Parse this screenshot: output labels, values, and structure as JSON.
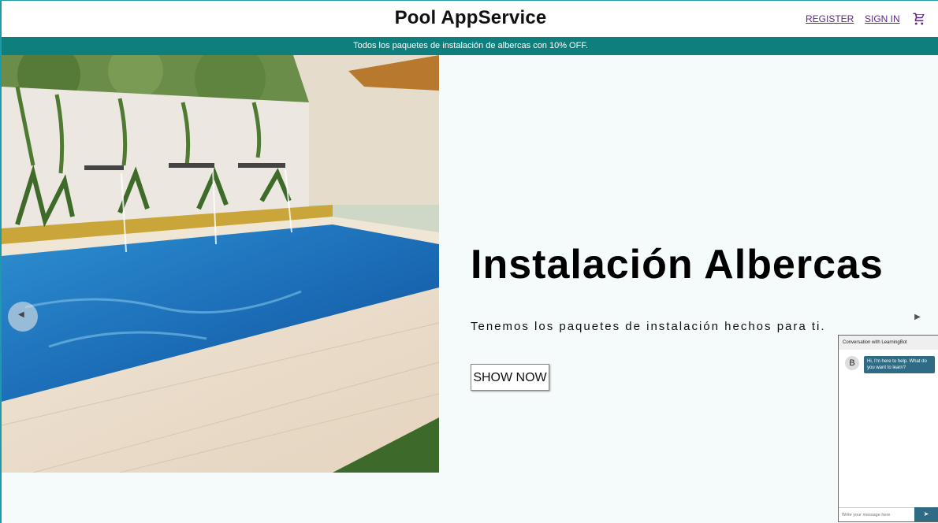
{
  "header": {
    "brand": "Pool AppService",
    "register": "REGISTER",
    "signin": "SIGN IN",
    "cart_icon": "cart-icon"
  },
  "promo": "Todos los paquetes de instalación de albercas con 10% OFF.",
  "hero": {
    "title": "Instalación Albercas",
    "subtitle": "Tenemos los paquetes de instalación hechos para ti.",
    "cta": "SHOW NOW"
  },
  "carousel": {
    "prev_icon": "chevron-left-icon",
    "next_icon": "chevron-right-icon"
  },
  "chat": {
    "title": "Conversation with LearningBot",
    "avatar": "B",
    "message": "Hi, I'm here to help. What do you want to learn?",
    "placeholder": "Write your message here",
    "send_icon": "send-icon"
  },
  "colors": {
    "accent": "#0e7f7d",
    "chat_accent": "#2f6b84",
    "link": "#5a2a82"
  }
}
